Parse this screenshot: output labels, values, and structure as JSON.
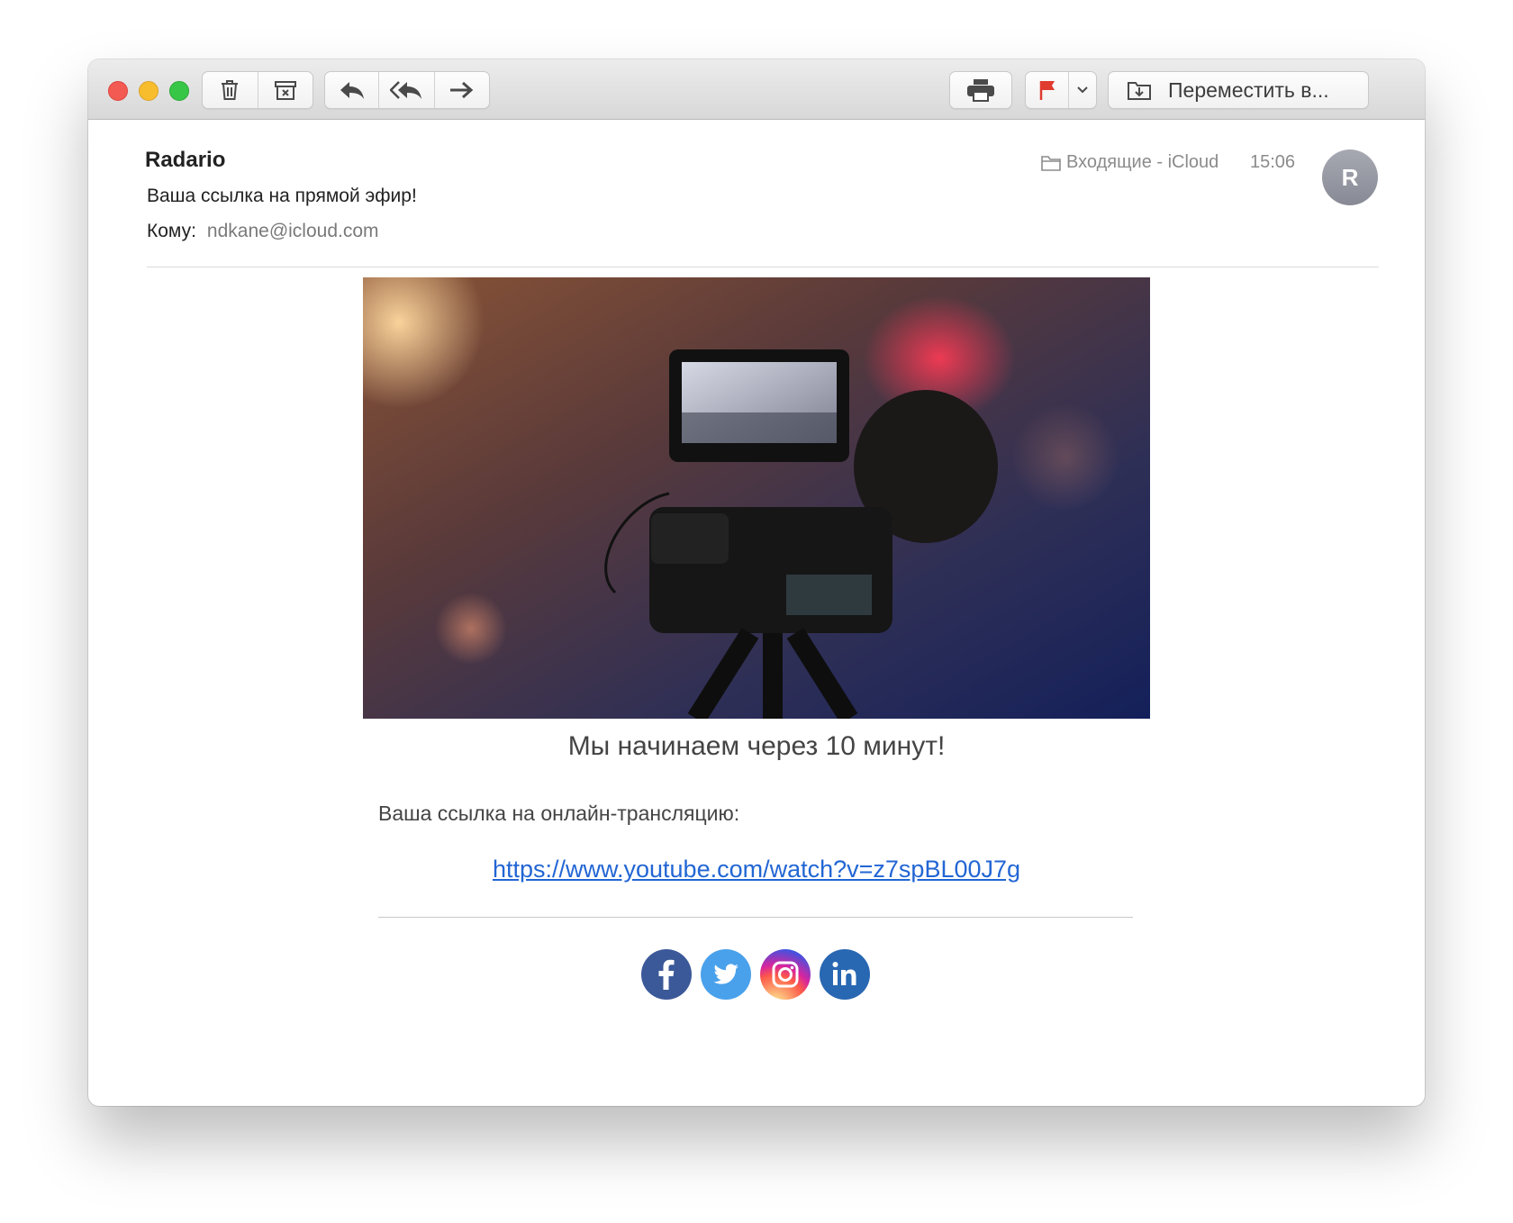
{
  "toolbar": {
    "delete_icon": "trash-icon",
    "archive_icon": "archive-icon",
    "reply_icon": "reply-icon",
    "reply_all_icon": "reply-all-icon",
    "forward_icon": "forward-icon",
    "print_icon": "printer-icon",
    "flag_icon": "flag-icon",
    "flag_color": "#e03b2f",
    "move_label": "Переместить в..."
  },
  "message": {
    "sender": "Radario",
    "subject": "Ваша ссылка на прямой эфир!",
    "to_label": "Кому:",
    "to_address": "ndkane@icloud.com",
    "mailbox": "Входящие - iCloud",
    "time": "15:06",
    "avatar_initial": "R"
  },
  "body": {
    "hero_image": "video-camera-photo",
    "headline": "Мы начинаем через 10 минут!",
    "intro": "Ваша ссылка на онлайн-трансляцию:",
    "link": "https://www.youtube.com/watch?v=z7spBL00J7g",
    "link_color": "#2266d4",
    "socials": [
      "facebook-icon",
      "twitter-icon",
      "instagram-icon",
      "linkedin-icon"
    ]
  }
}
